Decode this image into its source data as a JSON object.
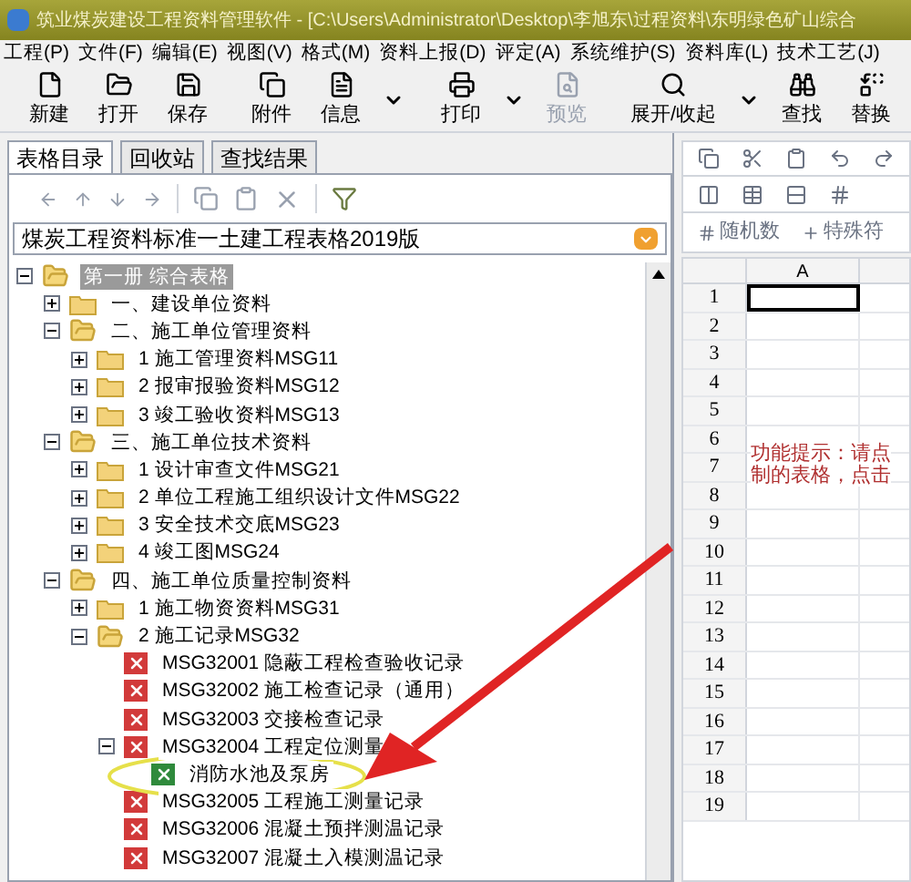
{
  "window": {
    "title": "筑业煤炭建设工程资料管理软件 - [C:\\Users\\Administrator\\Desktop\\李旭东\\过程资料\\东明绿色矿山综合"
  },
  "menu": [
    "工程(P)",
    "文件(F)",
    "编辑(E)",
    "视图(V)",
    "格式(M)",
    "资料上报(D)",
    "评定(A)",
    "系统维护(S)",
    "资料库(L)",
    "技术工艺(J)"
  ],
  "toolbar": [
    {
      "kind": "button",
      "label": "新建",
      "disabled": false
    },
    {
      "kind": "button",
      "label": "打开",
      "disabled": false
    },
    {
      "kind": "button",
      "label": "保存",
      "disabled": false
    },
    {
      "kind": "separator"
    },
    {
      "kind": "button",
      "label": "附件",
      "disabled": false
    },
    {
      "kind": "button",
      "label": "信息",
      "disabled": false
    },
    {
      "kind": "caret"
    },
    {
      "kind": "separator"
    },
    {
      "kind": "button",
      "label": "打印",
      "disabled": false
    },
    {
      "kind": "caret"
    },
    {
      "kind": "button",
      "label": "预览",
      "disabled": true
    },
    {
      "kind": "separator"
    },
    {
      "kind": "button",
      "label": "展开/收起",
      "disabled": false
    },
    {
      "kind": "caret"
    },
    {
      "kind": "button",
      "label": "查找",
      "disabled": false
    },
    {
      "kind": "button",
      "label": "替换",
      "disabled": false
    }
  ],
  "left_panel": {
    "tabs": [
      {
        "label": "表格目录",
        "selected": true
      },
      {
        "label": "回收站",
        "selected": false
      },
      {
        "label": "查找结果",
        "selected": false
      }
    ],
    "combo": {
      "value": "煤炭工程资料标准一土建工程表格2019版"
    },
    "tree": [
      {
        "kind": "folder",
        "label": "第一册 综合表格",
        "expanded": true,
        "selected": true,
        "children": [
          {
            "kind": "folder",
            "label": "一、建设单位资料",
            "expanded": false,
            "selected": false
          },
          {
            "kind": "folder",
            "label": "二、施工单位管理资料",
            "expanded": true,
            "selected": false,
            "children": [
              {
                "kind": "folder",
                "label": "1 施工管理资料MSG11",
                "expanded": false,
                "selected": false
              },
              {
                "kind": "folder",
                "label": "2 报审报验资料MSG12",
                "expanded": false,
                "selected": false
              },
              {
                "kind": "folder",
                "label": "3 竣工验收资料MSG13",
                "expanded": false,
                "selected": false
              }
            ]
          },
          {
            "kind": "folder",
            "label": "三、施工单位技术资料",
            "expanded": true,
            "selected": false,
            "children": [
              {
                "kind": "folder",
                "label": "1 设计审查文件MSG21",
                "expanded": false,
                "selected": false
              },
              {
                "kind": "folder",
                "label": "2 单位工程施工组织设计文件MSG22",
                "expanded": false,
                "selected": false
              },
              {
                "kind": "folder",
                "label": "3 安全技术交底MSG23",
                "expanded": false,
                "selected": false
              },
              {
                "kind": "folder",
                "label": "4 竣工图MSG24",
                "expanded": false,
                "selected": false
              }
            ]
          },
          {
            "kind": "folder",
            "label": "四、施工单位质量控制资料",
            "expanded": true,
            "selected": false,
            "children": [
              {
                "kind": "folder",
                "label": "1 施工物资资料MSG31",
                "expanded": false,
                "selected": false
              },
              {
                "kind": "folder",
                "label": "2 施工记录MSG32",
                "expanded": true,
                "selected": false,
                "children": [
                  {
                    "kind": "form",
                    "label": "MSG32001 隐蔽工程检查验收记录",
                    "color": "#d23a3a",
                    "selected": false
                  },
                  {
                    "kind": "form",
                    "label": "MSG32002 施工检查记录（通用）",
                    "color": "#d23a3a",
                    "selected": false
                  },
                  {
                    "kind": "form",
                    "label": "MSG32003 交接检查记录",
                    "color": "#d23a3a",
                    "selected": false
                  },
                  {
                    "kind": "form",
                    "label": "MSG32004 工程定位测量",
                    "color": "#d23a3a",
                    "expanded": true,
                    "selected": false,
                    "children": [
                      {
                        "kind": "form",
                        "label": "消防水池及泵房",
                        "color": "#2f8a3c",
                        "selected": false
                      }
                    ]
                  },
                  {
                    "kind": "form",
                    "label": "MSG32005 工程施工测量记录",
                    "color": "#d23a3a",
                    "selected": false
                  },
                  {
                    "kind": "form",
                    "label": "MSG32006 混凝土预拌测温记录",
                    "color": "#d23a3a",
                    "selected": false
                  },
                  {
                    "kind": "form",
                    "label": "MSG32007 混凝土入模测温记录",
                    "color": "#d23a3a",
                    "selected": false
                  }
                ]
              }
            ]
          }
        ]
      }
    ]
  },
  "sheet": {
    "tools": [
      "随机数",
      "特殊符"
    ],
    "columns": [
      "A"
    ],
    "rows": [
      "1",
      "2",
      "3",
      "4",
      "5",
      "6",
      "7",
      "8",
      "9",
      "10",
      "11",
      "12",
      "13",
      "14",
      "15",
      "16",
      "17",
      "18",
      "19"
    ],
    "hint": [
      "功能提示：请点",
      "制的表格，点击"
    ]
  }
}
